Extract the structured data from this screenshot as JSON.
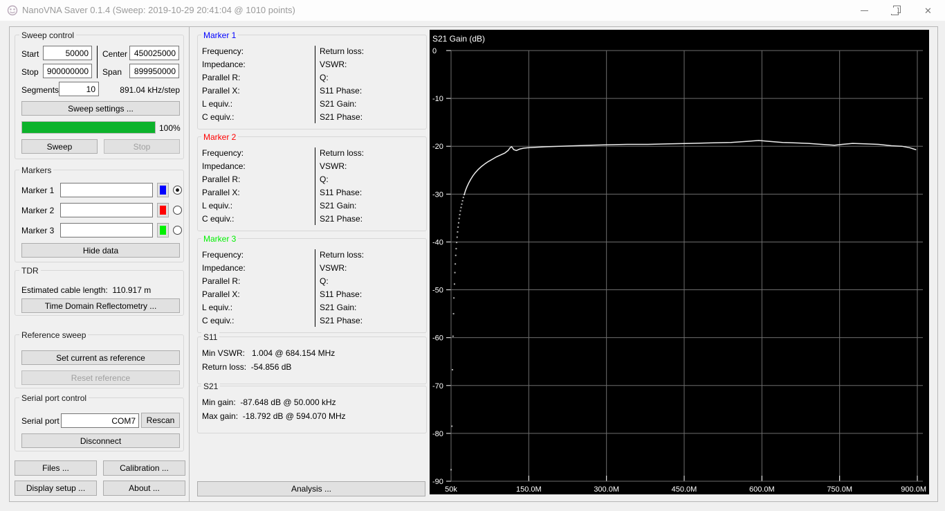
{
  "window": {
    "title": "NanoVNA Saver 0.1.4 (Sweep: 2019-10-29 20:41:04 @ 1010 points)"
  },
  "sweep_control": {
    "title": "Sweep control",
    "start_label": "Start",
    "start_value": "50000",
    "stop_label": "Stop",
    "stop_value": "900000000",
    "center_label": "Center",
    "center_value": "450025000",
    "span_label": "Span",
    "span_value": "899950000",
    "segments_label": "Segments",
    "segments_value": "10",
    "step_text": "891.04 kHz/step",
    "sweep_settings_button": "Sweep settings ...",
    "progress_percent": "100%",
    "progress_value": 100,
    "sweep_button": "Sweep",
    "stop_button": "Stop"
  },
  "markers_panel": {
    "title": "Markers",
    "rows": [
      {
        "label": "Marker 1",
        "value": "",
        "color": "#0000ff",
        "selected": true
      },
      {
        "label": "Marker 2",
        "value": "",
        "color": "#ff0000",
        "selected": false
      },
      {
        "label": "Marker 3",
        "value": "",
        "color": "#00f000",
        "selected": false
      }
    ],
    "hide_data_button": "Hide data"
  },
  "tdr": {
    "title": "TDR",
    "cable_length_label": "Estimated cable length:",
    "cable_length_value": "110.917 m",
    "tdr_button": "Time Domain Reflectometry ..."
  },
  "reference_sweep": {
    "title": "Reference sweep",
    "set_button": "Set current as reference",
    "reset_button": "Reset reference"
  },
  "serial_port": {
    "title": "Serial port control",
    "port_label": "Serial port",
    "port_value": "COM7",
    "rescan_button": "Rescan",
    "disconnect_button": "Disconnect"
  },
  "action_buttons": {
    "files": "Files ...",
    "calibration": "Calibration ...",
    "display_setup": "Display setup ...",
    "about": "About ...",
    "analysis": "Analysis ..."
  },
  "marker_info_sections": [
    {
      "title": "Marker 1",
      "color": "#0000ff",
      "left_fields": [
        "Frequency:",
        "Impedance:",
        "Parallel R:",
        "Parallel X:",
        "L equiv.:",
        "C equiv.:"
      ],
      "right_fields": [
        "Return loss:",
        "VSWR:",
        "Q:",
        "S11 Phase:",
        "S21 Gain:",
        "S21 Phase:"
      ]
    },
    {
      "title": "Marker 2",
      "color": "#ff0000",
      "left_fields": [
        "Frequency:",
        "Impedance:",
        "Parallel R:",
        "Parallel X:",
        "L equiv.:",
        "C equiv.:"
      ],
      "right_fields": [
        "Return loss:",
        "VSWR:",
        "Q:",
        "S11 Phase:",
        "S21 Gain:",
        "S21 Phase:"
      ]
    },
    {
      "title": "Marker 3",
      "color": "#00f000",
      "left_fields": [
        "Frequency:",
        "Impedance:",
        "Parallel R:",
        "Parallel X:",
        "L equiv.:",
        "C equiv.:"
      ],
      "right_fields": [
        "Return loss:",
        "VSWR:",
        "Q:",
        "S11 Phase:",
        "S21 Gain:",
        "S21 Phase:"
      ]
    }
  ],
  "s11_info": {
    "title": "S11",
    "rows": [
      {
        "label": "Min VSWR:",
        "value": "1.004 @ 684.154 MHz"
      },
      {
        "label": "Return loss:",
        "value": "-54.856 dB"
      }
    ]
  },
  "s21_info": {
    "title": "S21",
    "rows": [
      {
        "label": "Min gain:",
        "value": "-87.648 dB @ 50.000 kHz"
      },
      {
        "label": "Max gain:",
        "value": "-18.792 dB @ 594.070 MHz"
      }
    ]
  },
  "chart_data": {
    "type": "line",
    "title": "S21 Gain (dB)",
    "background": "#000000",
    "grid": true,
    "grid_color": "#6e6e6e",
    "x_axis": {
      "tick_labels": [
        "50k",
        "150.0M",
        "300.0M",
        "450.0M",
        "600.0M",
        "750.0M",
        "900.0M"
      ],
      "tick_mhz": [
        0.05,
        150,
        300,
        450,
        600,
        750,
        900
      ],
      "range_mhz": [
        0.05,
        900
      ]
    },
    "y_axis": {
      "tick_labels": [
        "0",
        "-10",
        "-20",
        "-30",
        "-40",
        "-50",
        "-60",
        "-70",
        "-80",
        "-90"
      ],
      "tick_db": [
        0,
        -10,
        -20,
        -30,
        -40,
        -50,
        -60,
        -70,
        -80,
        -90
      ],
      "range_db": [
        -90,
        0
      ],
      "unit": "dB"
    },
    "series": [
      {
        "name": "S21 Gain",
        "color": "#ededed",
        "scatter_points_mhz_db": [
          [
            0.05,
            -87.6
          ],
          [
            1.6,
            -78.5
          ],
          [
            2.7,
            -66.7
          ],
          [
            3.8,
            -59.7
          ],
          [
            4.8,
            -55.0
          ],
          [
            5.5,
            -51.7
          ],
          [
            6.6,
            -48.8
          ],
          [
            7.4,
            -46.4
          ],
          [
            8.2,
            -44.6
          ],
          [
            9.0,
            -42.8
          ],
          [
            9.9,
            -41.4
          ],
          [
            10.8,
            -40.1
          ],
          [
            11.7,
            -39.0
          ],
          [
            12.6,
            -37.9
          ],
          [
            13.6,
            -36.9
          ],
          [
            14.6,
            -36.0
          ],
          [
            15.7,
            -35.1
          ],
          [
            16.8,
            -34.3
          ],
          [
            18.0,
            -33.5
          ],
          [
            19.3,
            -32.8
          ],
          [
            20.7,
            -32.1
          ],
          [
            22.2,
            -31.4
          ],
          [
            23.8,
            -30.7
          ],
          [
            25.5,
            -30.1
          ]
        ],
        "line_points_mhz_db": [
          [
            25.5,
            -30.1
          ],
          [
            28,
            -29.2
          ],
          [
            31,
            -28.4
          ],
          [
            34,
            -27.7
          ],
          [
            38,
            -26.9
          ],
          [
            42,
            -26.2
          ],
          [
            47,
            -25.5
          ],
          [
            52,
            -24.9
          ],
          [
            58,
            -24.3
          ],
          [
            65,
            -23.7
          ],
          [
            72,
            -23.2
          ],
          [
            80,
            -22.7
          ],
          [
            88,
            -22.2
          ],
          [
            96,
            -21.8
          ],
          [
            104,
            -21.4
          ],
          [
            110,
            -20.9
          ],
          [
            114,
            -20.3
          ],
          [
            117,
            -20.1
          ],
          [
            121,
            -20.7
          ],
          [
            126,
            -20.9
          ],
          [
            132,
            -20.6
          ],
          [
            140,
            -20.4
          ],
          [
            150,
            -20.3
          ],
          [
            165,
            -20.2
          ],
          [
            185,
            -20.1
          ],
          [
            210,
            -20.0
          ],
          [
            240,
            -19.9
          ],
          [
            270,
            -19.8
          ],
          [
            300,
            -19.7
          ],
          [
            340,
            -19.6
          ],
          [
            380,
            -19.6
          ],
          [
            420,
            -19.5
          ],
          [
            460,
            -19.4
          ],
          [
            500,
            -19.3
          ],
          [
            540,
            -19.2
          ],
          [
            570,
            -19.0
          ],
          [
            594,
            -18.8
          ],
          [
            615,
            -19.0
          ],
          [
            640,
            -19.2
          ],
          [
            665,
            -19.3
          ],
          [
            690,
            -19.4
          ],
          [
            715,
            -19.6
          ],
          [
            740,
            -19.8
          ],
          [
            755,
            -19.6
          ],
          [
            775,
            -19.4
          ],
          [
            800,
            -19.5
          ],
          [
            825,
            -19.6
          ],
          [
            850,
            -19.9
          ],
          [
            870,
            -20.0
          ],
          [
            885,
            -20.3
          ],
          [
            897,
            -20.7
          ]
        ]
      }
    ]
  }
}
